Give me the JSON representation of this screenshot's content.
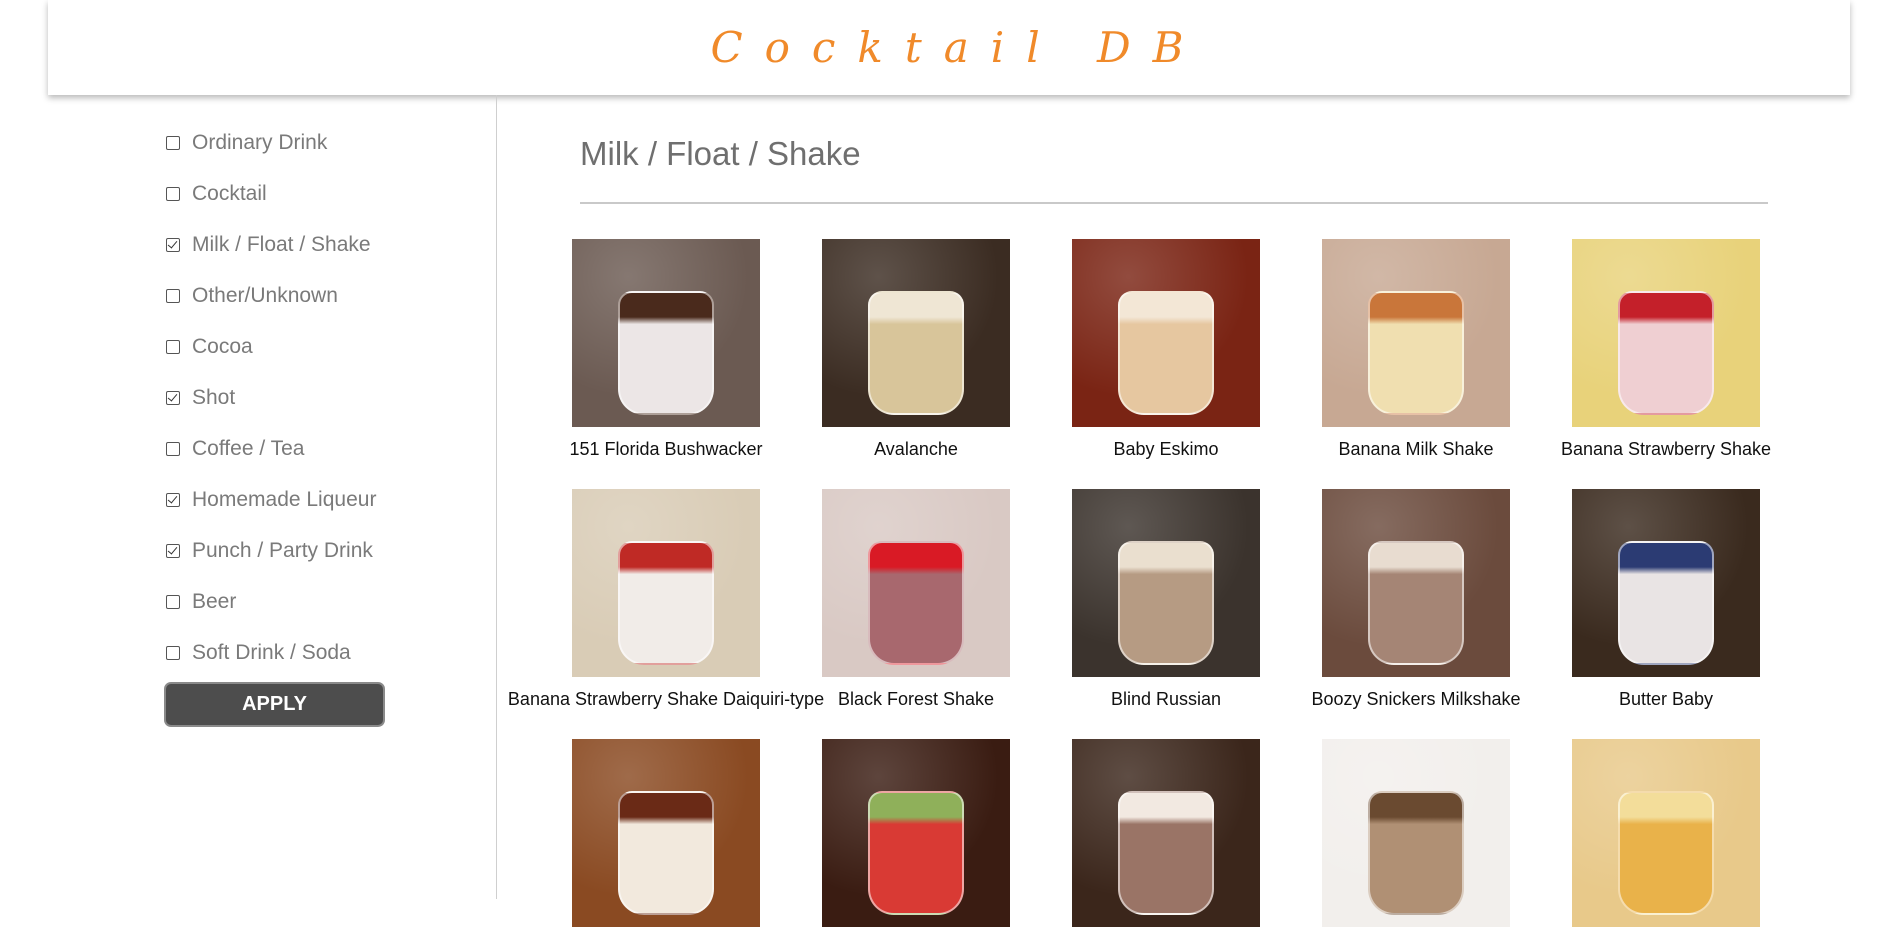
{
  "header": {
    "title": "Cocktail DB"
  },
  "sidebar": {
    "filters": [
      {
        "label": "Ordinary Drink",
        "checked": false
      },
      {
        "label": "Cocktail",
        "checked": false
      },
      {
        "label": "Milk / Float / Shake",
        "checked": true
      },
      {
        "label": "Other/Unknown",
        "checked": false
      },
      {
        "label": "Cocoa",
        "checked": false
      },
      {
        "label": "Shot",
        "checked": true
      },
      {
        "label": "Coffee / Tea",
        "checked": false
      },
      {
        "label": "Homemade Liqueur",
        "checked": true
      },
      {
        "label": "Punch / Party Drink",
        "checked": true
      },
      {
        "label": "Beer",
        "checked": false
      },
      {
        "label": "Soft Drink / Soda",
        "checked": false
      }
    ],
    "apply_label": "APPLY"
  },
  "main": {
    "category_title": "Milk / Float / Shake",
    "drinks": [
      {
        "name": "151 Florida Bushwacker",
        "bg": "#6b5a52",
        "drink": "#ece6e6",
        "top": "#4a2a1c"
      },
      {
        "name": "Avalanche",
        "bg": "#3b2c22",
        "drink": "#d8c59a",
        "top": "#efe6d4"
      },
      {
        "name": "Baby Eskimo",
        "bg": "#7a2414",
        "drink": "#e6c7a0",
        "top": "#f3e7d6"
      },
      {
        "name": "Banana Milk Shake",
        "bg": "#c7a893",
        "drink": "#f0dfb0",
        "top": "#c9763a"
      },
      {
        "name": "Banana Strawberry Shake",
        "bg": "#e8d27a",
        "drink": "#efcfd2",
        "top": "#c4202a"
      },
      {
        "name": "Banana Strawberry Shake Daiquiri-type",
        "bg": "#d9ccb6",
        "drink": "#f1ece8",
        "top": "#bf2a25"
      },
      {
        "name": "Black Forest Shake",
        "bg": "#d9c9c4",
        "drink": "#a8686e",
        "top": "#d91a25"
      },
      {
        "name": "Blind Russian",
        "bg": "#3b332d",
        "drink": "#b69b83",
        "top": "#eadfcf"
      },
      {
        "name": "Boozy Snickers Milkshake",
        "bg": "#6b4b3d",
        "drink": "#a58575",
        "top": "#e8dcd0"
      },
      {
        "name": "Butter Baby",
        "bg": "#3a2a1e",
        "drink": "#e9e4e4",
        "top": "#2b3b73"
      },
      {
        "name": "",
        "bg": "#8a4a22",
        "drink": "#f2e9dd",
        "top": "#6a2a16"
      },
      {
        "name": "",
        "bg": "#3a1c12",
        "drink": "#d93a34",
        "top": "#8fb05a"
      },
      {
        "name": "",
        "bg": "#3b261b",
        "drink": "#9a7466",
        "top": "#f2e9e1"
      },
      {
        "name": "",
        "bg": "#f2efec",
        "drink": "#b09074",
        "top": "#6a4a30"
      },
      {
        "name": "",
        "bg": "#e8c98a",
        "drink": "#e9b24a",
        "top": "#f3dd9a"
      }
    ]
  }
}
